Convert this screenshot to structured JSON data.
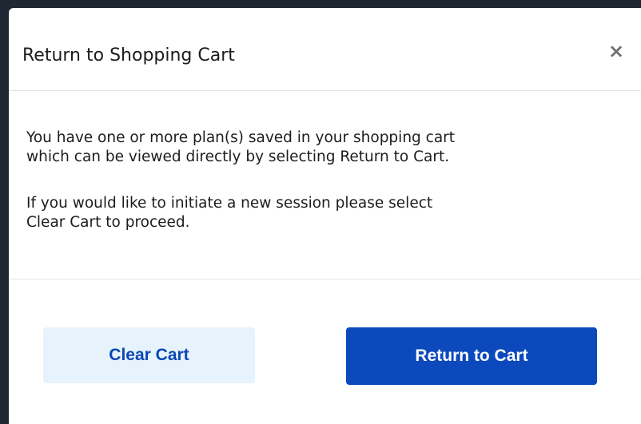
{
  "dialog": {
    "title": "Return to Shopping Cart",
    "close_glyph": "×",
    "close_icon": "close-icon"
  },
  "body": {
    "paragraph_1": {
      "line_1": "You have one or more plan(s) saved in your shopping cart",
      "line_2": "which can be viewed directly by selecting Return to Cart."
    },
    "paragraph_2": {
      "line_1": "If you would like to initiate a new session please select",
      "line_2": "Clear Cart to proceed."
    }
  },
  "footer": {
    "clear_label": "Clear Cart",
    "return_label": "Return to Cart"
  },
  "colors": {
    "primary": "#0b49bd",
    "secondary_bg": "#e6f2fc",
    "secondary_text": "#0a46b4",
    "backdrop": "#1f2733"
  }
}
